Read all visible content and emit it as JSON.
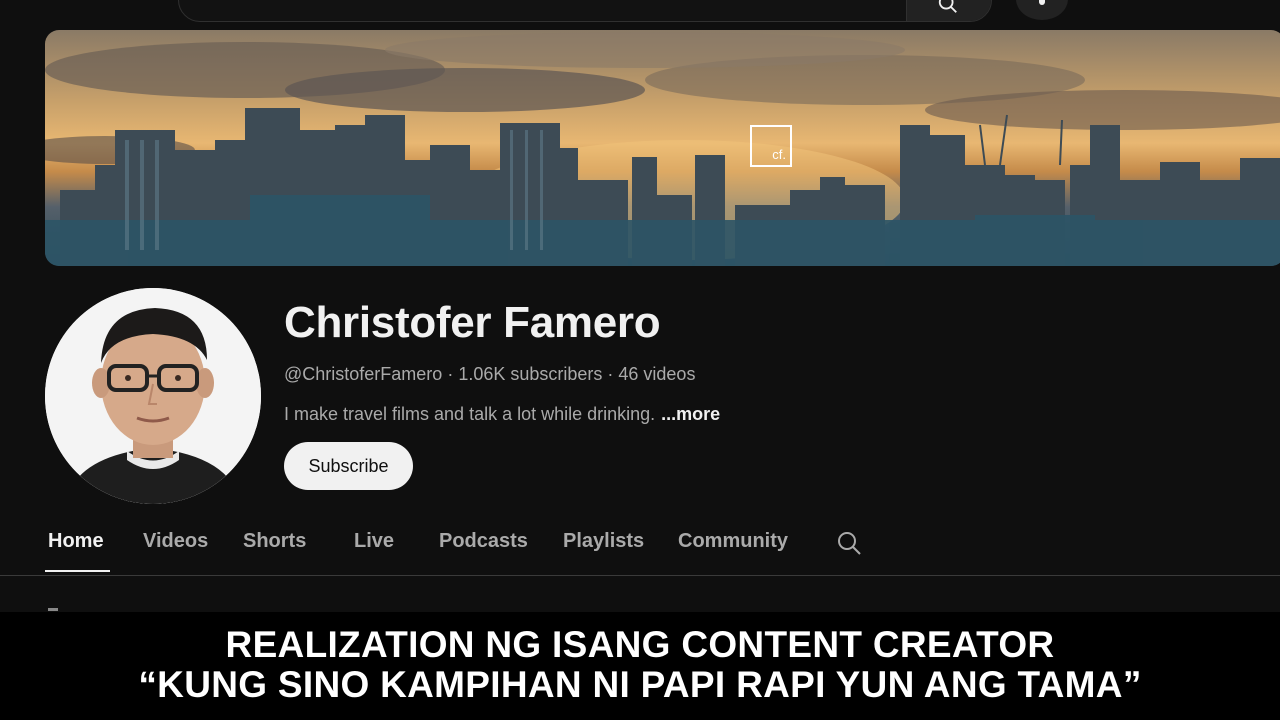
{
  "header": {
    "search_icon": "search-icon",
    "mic_icon": "mic-icon"
  },
  "banner": {
    "logo_text": "cf."
  },
  "channel": {
    "name": "Christofer Famero",
    "handle": "@ChristoferFamero",
    "subscribers": "1.06K subscribers",
    "videos": "46 videos",
    "separator": "·",
    "description": "I make travel films and talk a lot while drinking.",
    "more_label": "...more",
    "subscribe_label": "Subscribe"
  },
  "tabs": [
    {
      "label": "Home",
      "active": true
    },
    {
      "label": "Videos"
    },
    {
      "label": "Shorts"
    },
    {
      "label": "Live"
    },
    {
      "label": "Podcasts"
    },
    {
      "label": "Playlists"
    },
    {
      "label": "Community"
    }
  ],
  "caption": {
    "line1": "REALIZATION NG ISANG CONTENT CREATOR",
    "line2": "“KUNG SINO KAMPIHAN NI PAPI RAPI YUN ANG TAMA”"
  },
  "colors": {
    "background": "#0f0f0f",
    "text_primary": "#f1f1f1",
    "text_secondary": "#aaaaaa",
    "subscribe_bg": "#f1f1f1"
  }
}
